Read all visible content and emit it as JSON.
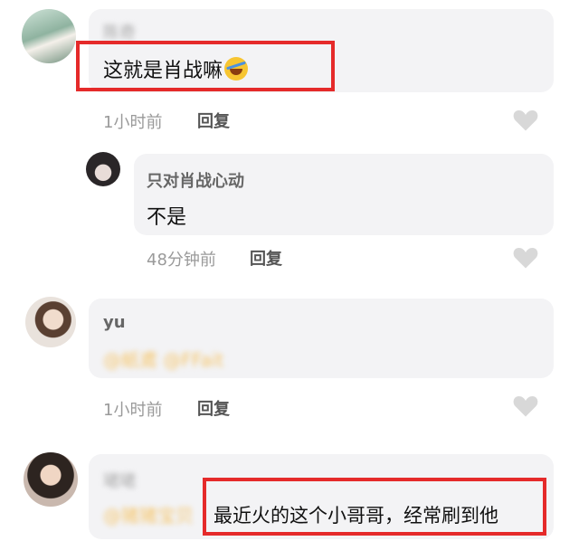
{
  "comments": [
    {
      "username": "陈奇",
      "text": "这就是肖战嘛",
      "emoji": "rofl-emoji",
      "time": "1小时前",
      "reply_label": "回复"
    },
    {
      "username": "只对肖战心动",
      "text": "不是",
      "time": "48分钟前",
      "reply_label": "回复"
    },
    {
      "username": "yu",
      "mention": "@紙鳶 @FFait",
      "time": "1小时前",
      "reply_label": "回复"
    },
    {
      "username": "珺珺",
      "mention": "@猪猪宝贝",
      "text": "最近火的这个小哥哥，经常刷到他"
    }
  ],
  "colors": {
    "highlight_border": "#e52a2a",
    "bubble_bg": "#f3f3f5",
    "mention": "#f5c56a"
  }
}
